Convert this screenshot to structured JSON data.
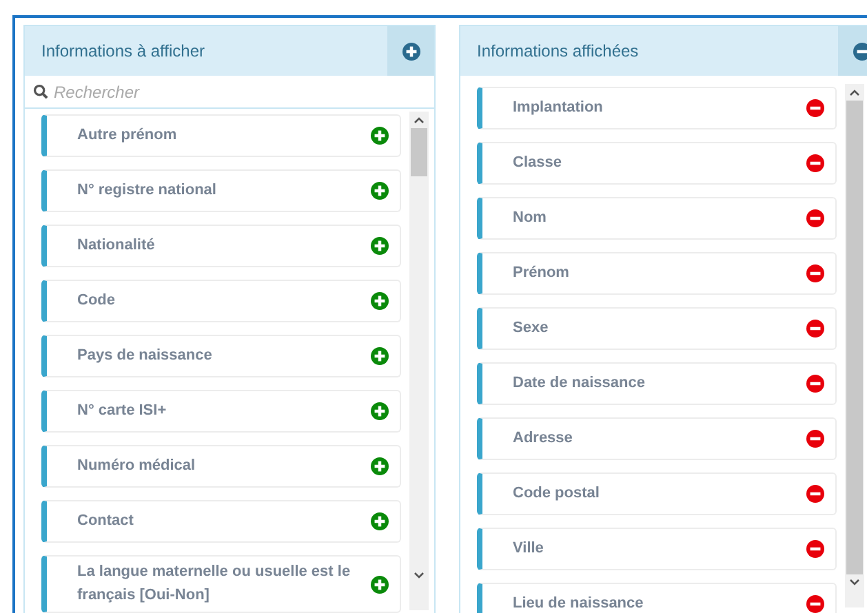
{
  "panels": [
    {
      "title": "Informations à afficher",
      "kind": "add",
      "search": {
        "placeholder": "Rechercher"
      },
      "items": [
        {
          "label": "Autre prénom"
        },
        {
          "label": "N° registre national"
        },
        {
          "label": "Nationalité"
        },
        {
          "label": "Code"
        },
        {
          "label": "Pays de naissance"
        },
        {
          "label": "N° carte ISI+"
        },
        {
          "label": "Numéro médical"
        },
        {
          "label": "Contact"
        },
        {
          "label": "La langue maternelle ou usuelle est le français [Oui-Non]"
        }
      ]
    },
    {
      "title": "Informations affichées",
      "kind": "remove",
      "items": [
        {
          "label": "Implantation"
        },
        {
          "label": "Classe"
        },
        {
          "label": "Nom"
        },
        {
          "label": "Prénom"
        },
        {
          "label": "Sexe"
        },
        {
          "label": "Date de naissance"
        },
        {
          "label": "Adresse"
        },
        {
          "label": "Code postal"
        },
        {
          "label": "Ville"
        },
        {
          "label": "Lieu de naissance"
        }
      ]
    }
  ]
}
